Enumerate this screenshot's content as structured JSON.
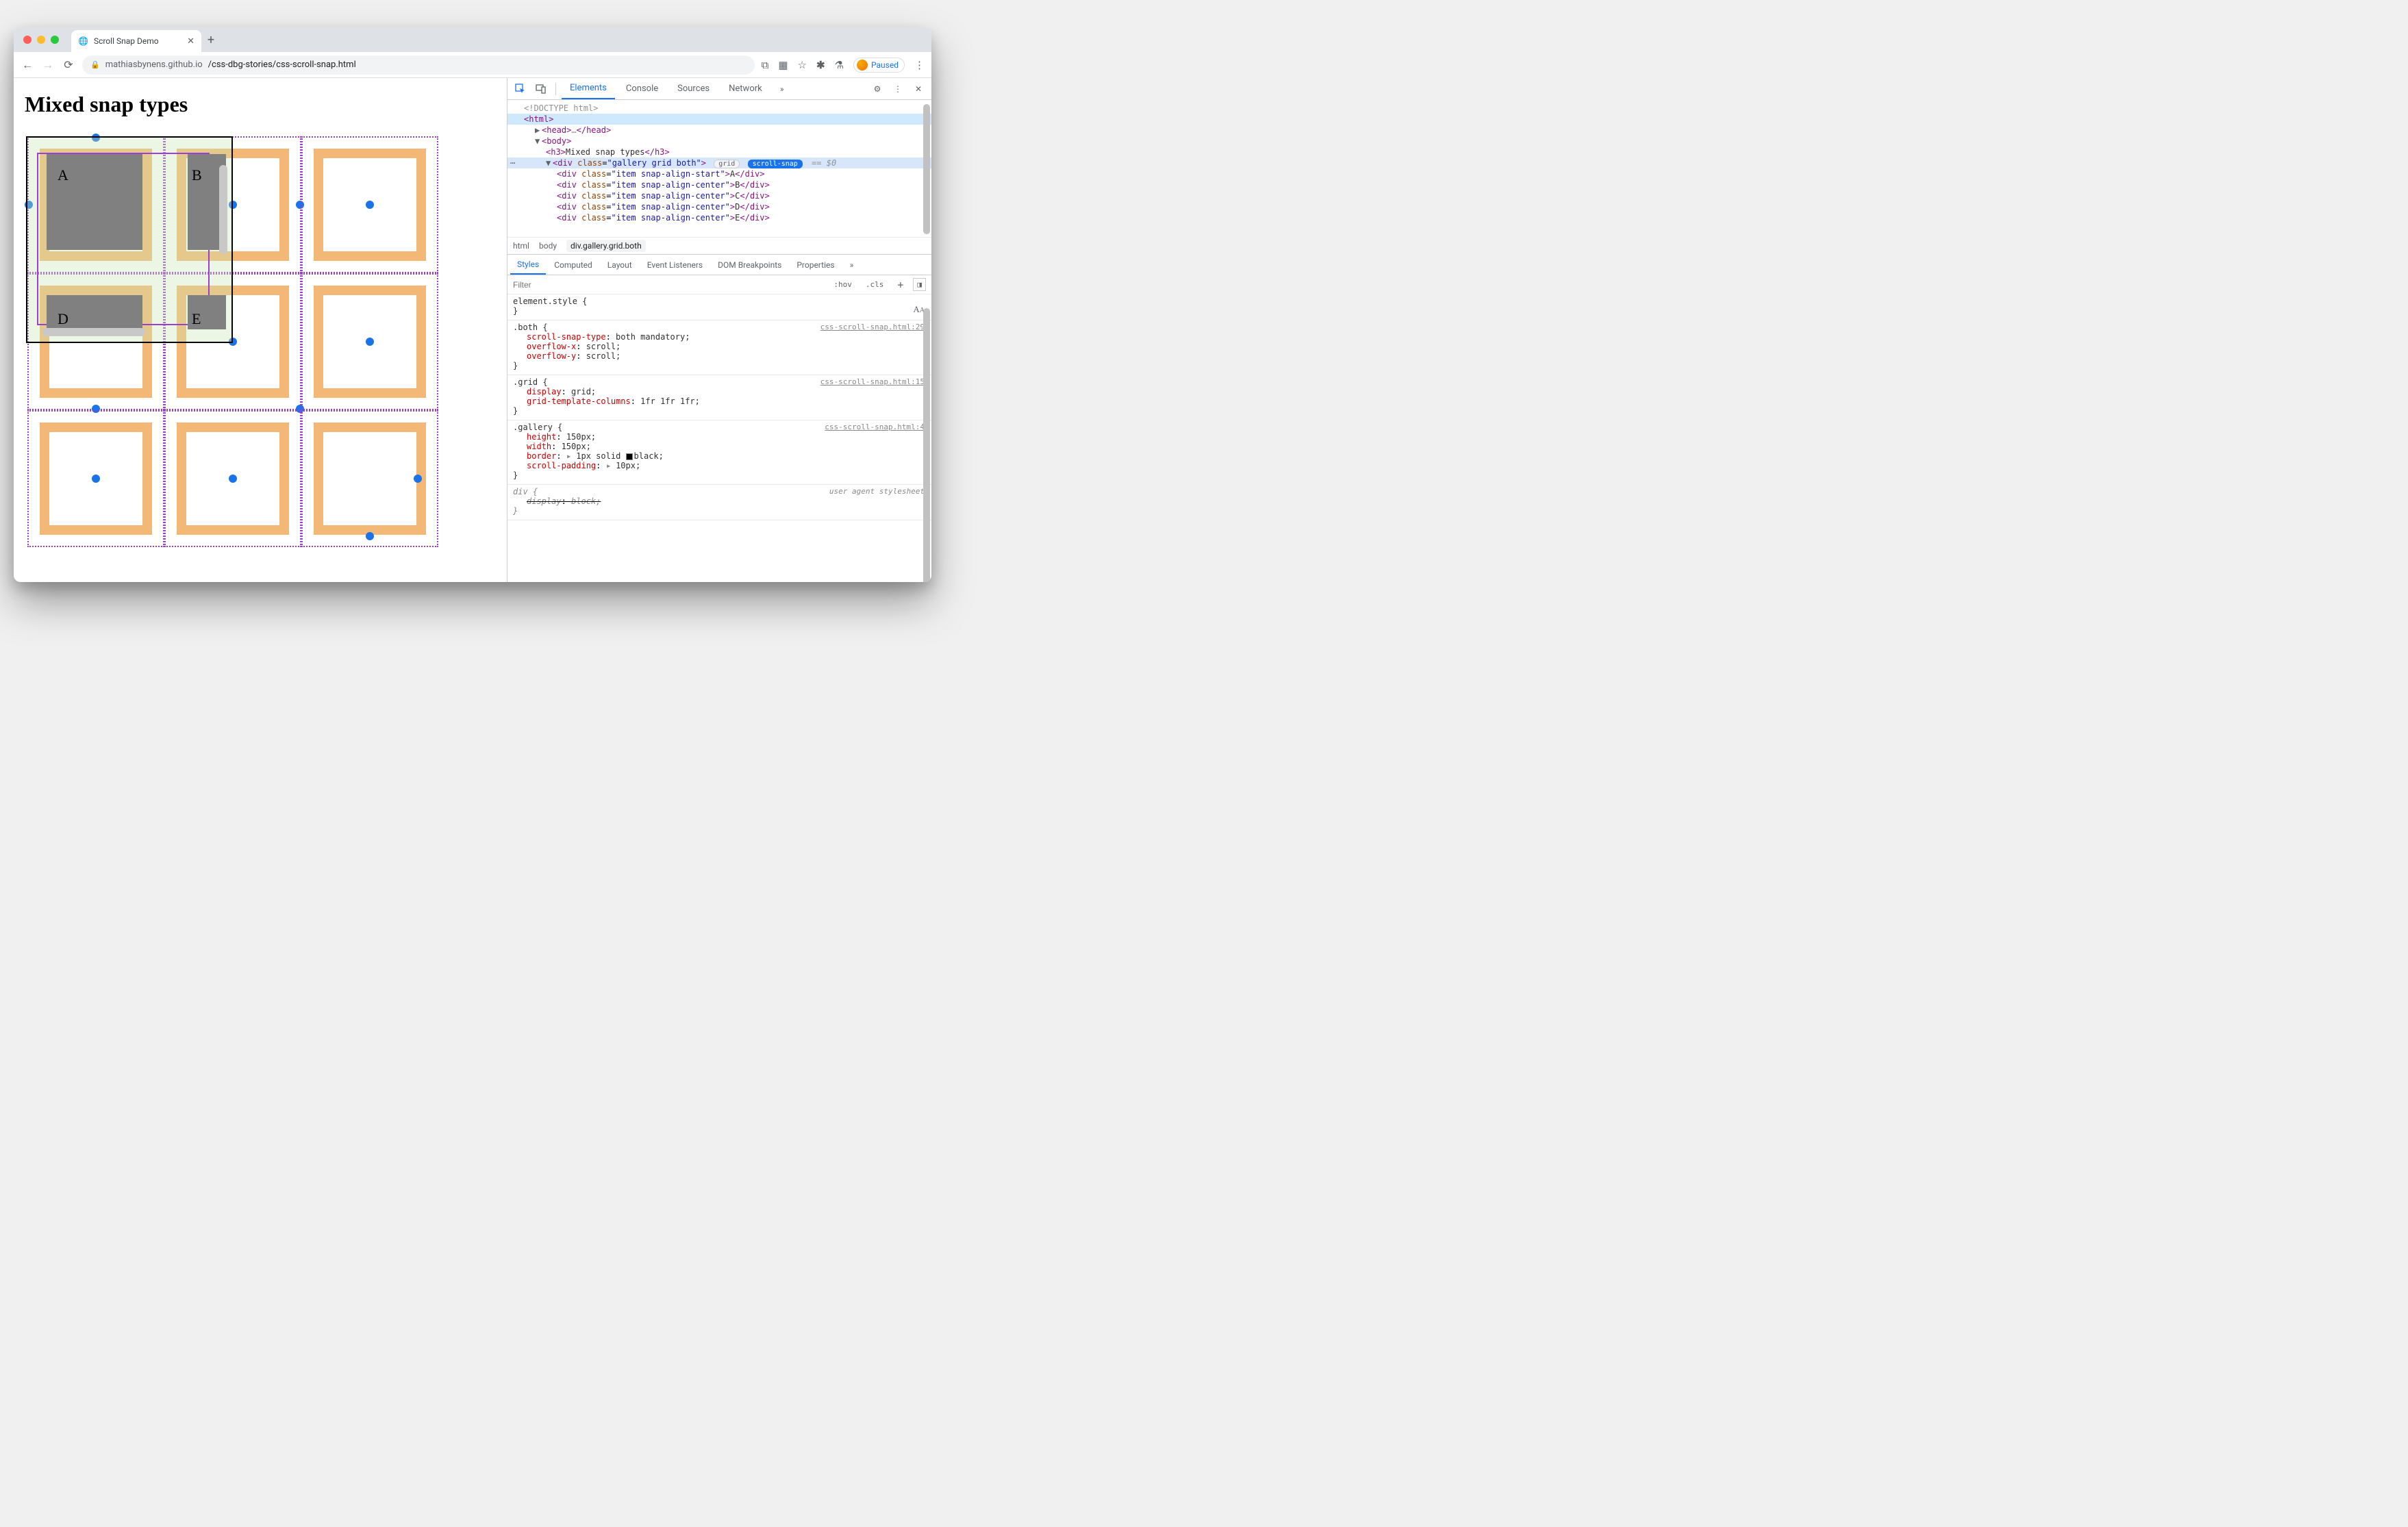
{
  "browser": {
    "tab_title": "Scroll Snap Demo",
    "url_host": "mathiasbynens.github.io",
    "url_path": "/css-dbg-stories/css-scroll-snap.html",
    "paused_label": "Paused"
  },
  "page": {
    "heading": "Mixed snap types",
    "gallery_items": {
      "A": "A",
      "B": "B",
      "D": "D",
      "E": "E"
    }
  },
  "devtools": {
    "tabs": [
      "Elements",
      "Console",
      "Sources",
      "Network"
    ],
    "active_tab": "Elements",
    "dom": {
      "doctype": "<!DOCTYPE html>",
      "html_open": "html",
      "head": "head",
      "body": "body",
      "h3_text": "Mixed snap types",
      "gallery_class": "gallery grid both",
      "badge_grid": "grid",
      "badge_snap": "scroll-snap",
      "eq0": "== $0",
      "items": [
        {
          "cls": "item snap-align-start",
          "txt": "A"
        },
        {
          "cls": "item snap-align-center",
          "txt": "B"
        },
        {
          "cls": "item snap-align-center",
          "txt": "C"
        },
        {
          "cls": "item snap-align-center",
          "txt": "D"
        },
        {
          "cls": "item snap-align-center",
          "txt": "E"
        }
      ]
    },
    "crumbs": [
      "html",
      "body",
      "div.gallery.grid.both"
    ],
    "styles_tabs": [
      "Styles",
      "Computed",
      "Layout",
      "Event Listeners",
      "DOM Breakpoints",
      "Properties"
    ],
    "filter_placeholder": "Filter",
    "hov": ":hov",
    "cls": ".cls",
    "rules": {
      "element_style": "element.style {",
      "both_src": "css-scroll-snap.html:29",
      "both_sel": ".both {",
      "both_p1n": "scroll-snap-type",
      "both_p1v": "both mandatory;",
      "both_p2n": "overflow-x",
      "both_p2v": "scroll;",
      "both_p3n": "overflow-y",
      "both_p3v": "scroll;",
      "grid_src": "css-scroll-snap.html:15",
      "grid_sel": ".grid {",
      "grid_p1n": "display",
      "grid_p1v": "grid;",
      "grid_p2n": "grid-template-columns",
      "grid_p2v": "1fr 1fr 1fr;",
      "gal_src": "css-scroll-snap.html:4",
      "gal_sel": ".gallery {",
      "gal_p1n": "height",
      "gal_p1v": "150px;",
      "gal_p2n": "width",
      "gal_p2v": "150px;",
      "gal_p3n": "border",
      "gal_p3v": "1px solid ",
      "gal_p3v2": "black;",
      "gal_p4n": "scroll-padding",
      "gal_p4v": "10px;",
      "ua_src": "user agent stylesheet",
      "ua_sel": "div {",
      "ua_p1n": "display",
      "ua_p1v": "block;",
      "brace_close": "}"
    }
  }
}
